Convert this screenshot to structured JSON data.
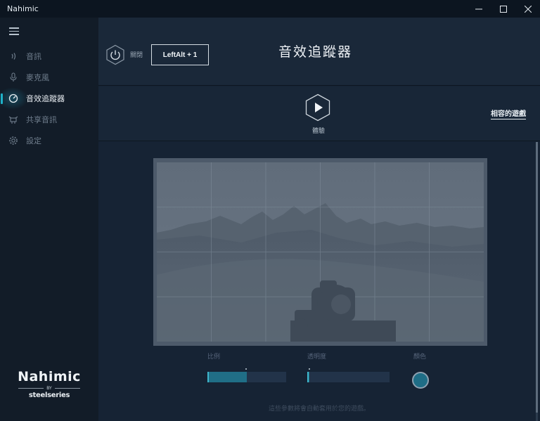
{
  "window": {
    "title": "Nahimic"
  },
  "sidebar": {
    "items": [
      {
        "label": "音訊",
        "icon": "audio-wave-icon",
        "active": false
      },
      {
        "label": "麥克風",
        "icon": "microphone-icon",
        "active": false
      },
      {
        "label": "音效追蹤器",
        "icon": "sound-tracker-icon",
        "active": true
      },
      {
        "label": "共享音訊",
        "icon": "sharing-icon",
        "active": false
      },
      {
        "label": "設定",
        "icon": "gear-icon",
        "active": false
      }
    ],
    "brand": {
      "name": "Nahimic",
      "by": "BY",
      "sub": "steelseries"
    }
  },
  "header": {
    "power_label": "關閉",
    "hotkey": "LeftAlt + 1",
    "title": "音效追蹤器"
  },
  "play_section": {
    "label": "體驗",
    "compat_link": "相容的遊戲"
  },
  "controls": {
    "scale_label": "比例",
    "scale_value": 0.5,
    "opacity_label": "透明度",
    "opacity_value": 0.02,
    "color_label": "顏色",
    "color_value": "#1f6d86",
    "footnote": "這些參數將會自動套用於您的遊戲。"
  },
  "colors": {
    "accent": "#1fb2c9",
    "background": "#162334",
    "sidebar": "#121c28"
  }
}
